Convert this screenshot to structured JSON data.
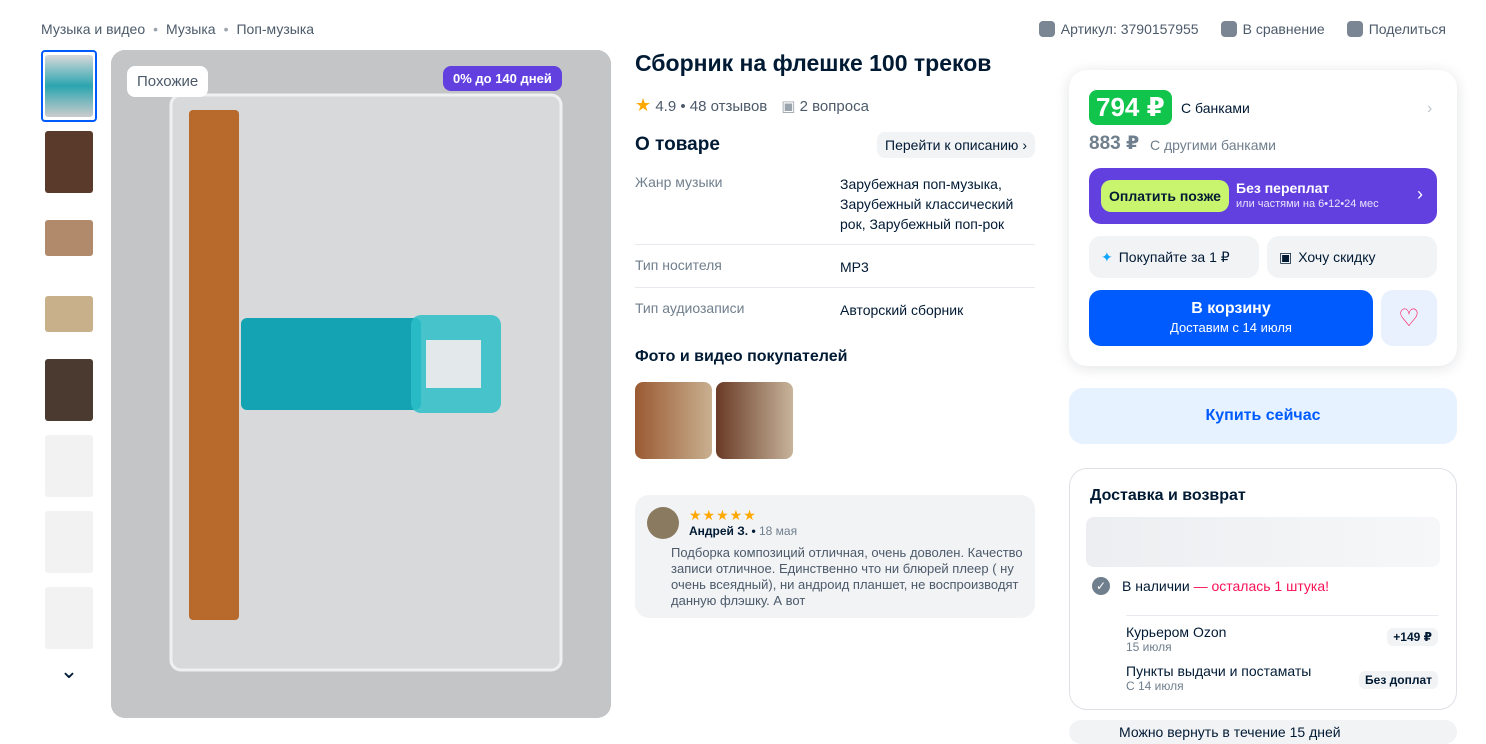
{
  "breadcrumb": [
    "Музыка и видео",
    "Музыка",
    "Поп-музыка"
  ],
  "toplinks": {
    "article": "Артикул: 3790157955",
    "compare": "В сравнение",
    "share": "Поделиться"
  },
  "gallery": {
    "similar": "Похожие",
    "installment": "0% до 140 дней"
  },
  "product": {
    "title": "Сборник на флешке 100 треков",
    "rating": "4.9 • 48 отзывов",
    "questions": "2 вопроса",
    "about": "О товаре",
    "goto_desc": "Перейти к описанию",
    "specs": [
      {
        "k": "Жанр музыки",
        "v": "Зарубежная поп-музыка, Зарубежный классический рок, Зарубежный поп-рок"
      },
      {
        "k": "Тип носителя",
        "v": "MP3"
      },
      {
        "k": "Тип аудиозаписи",
        "v": "Авторский сборник"
      }
    ],
    "photos_title": "Фото и видео покупателей"
  },
  "review": {
    "stars": "★★★★★",
    "author": "Андрей З.",
    "date": "18 мая",
    "text": "Подборка композиций отличная, очень доволен. Качество записи отличное. Единственно что ни блюрей плеер ( ну очень всеядный), ни андроид планшет, не воспроизводят данную флэшку. А вот"
  },
  "buy": {
    "price": "794 ₽",
    "with_banks": "С банками",
    "old_price": "883 ₽",
    "other_banks": "С другими банками",
    "pay_later": "Оплатить позже",
    "no_overpay": "Без переплат",
    "parts": "или частями на 6•12•24 мес",
    "buy_for_1": "Покупайте за 1 ₽",
    "want_discount": "Хочу скидку",
    "cart": "В корзину",
    "cart_sub": "Доставим с 14 июля",
    "buy_now": "Купить сейчас"
  },
  "delivery": {
    "title": "Доставка и возврат",
    "available": "В наличии",
    "left": "— осталась 1 штука!",
    "courier": "Курьером Ozon",
    "courier_date": "15 июля",
    "courier_price": "+149 ₽",
    "pickup": "Пункты выдачи и постаматы",
    "pickup_date": "С 14 июля",
    "pickup_price": "Без доплат",
    "return": "Можно вернуть в течение 15 дней"
  },
  "colors": {
    "accent": "#005bff",
    "price_green": "#10c44c",
    "purple": "#6240e0"
  }
}
